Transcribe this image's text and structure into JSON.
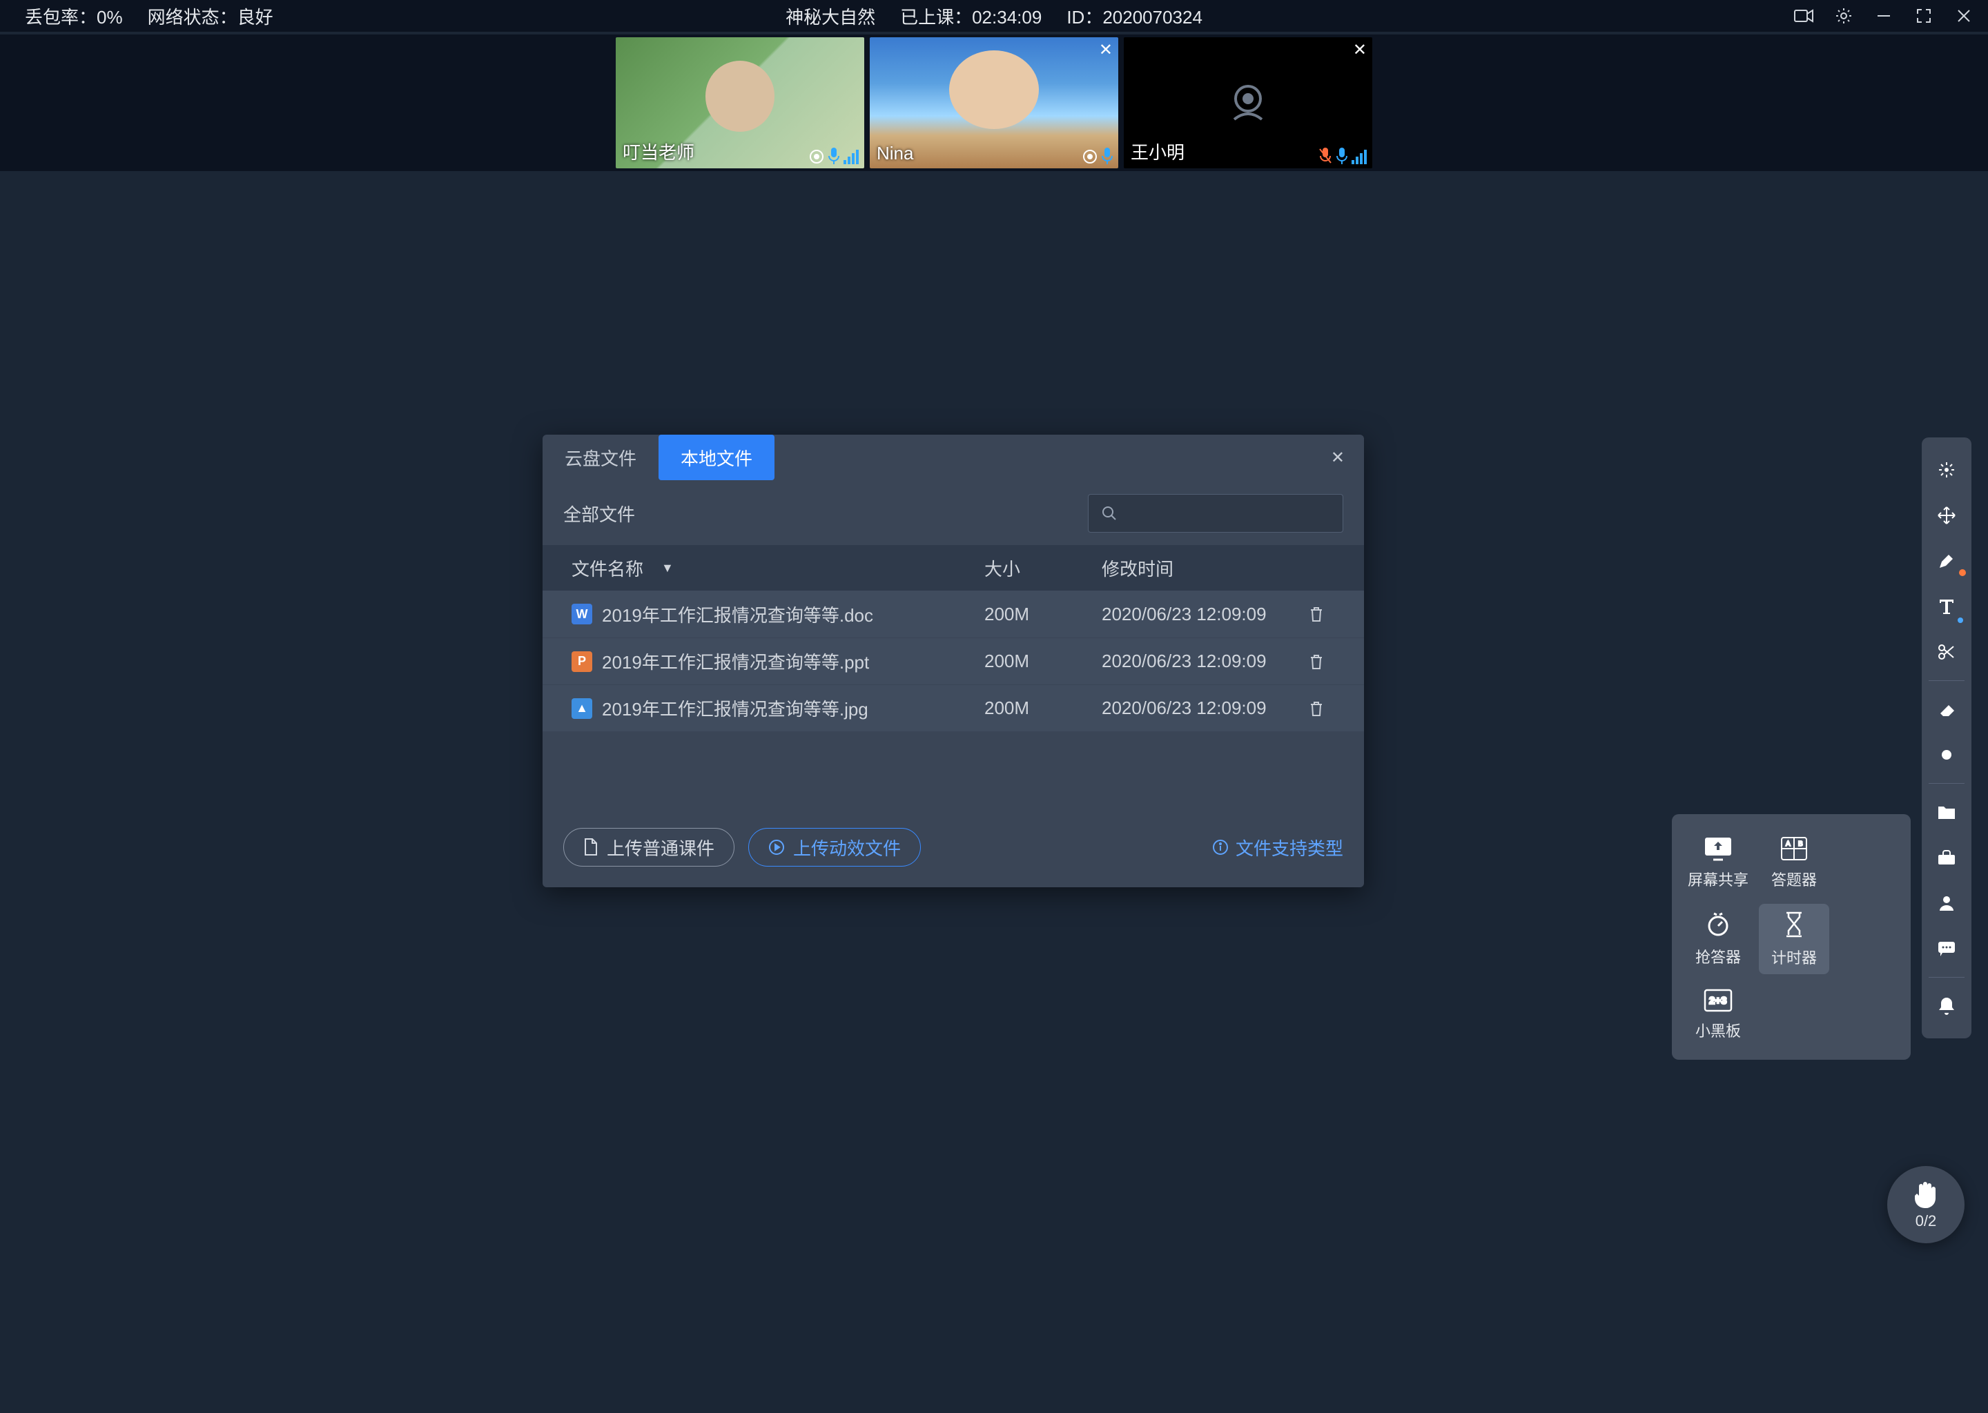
{
  "top": {
    "loss_label": "丢包率：",
    "loss_value": "0%",
    "net_label": "网络状态：",
    "net_value": "良好",
    "title": "神秘大自然",
    "elapsed_label": "已上课：",
    "elapsed_value": "02:34:09",
    "id_label": "ID：",
    "id_value": "2020070324"
  },
  "videos": [
    {
      "name": "叮当老师",
      "camera": true,
      "mic": "on",
      "closable": false
    },
    {
      "name": "Nina",
      "camera": true,
      "mic": "on",
      "closable": true
    },
    {
      "name": "王小明",
      "camera": false,
      "mic": "off",
      "closable": true
    }
  ],
  "dialog": {
    "tabs": {
      "cloud": "云盘文件",
      "local": "本地文件"
    },
    "all_files": "全部文件",
    "headers": {
      "name": "文件名称",
      "size": "大小",
      "time": "修改时间"
    },
    "rows": [
      {
        "icon": "W",
        "iconClass": "fi-doc",
        "name": "2019年工作汇报情况查询等等.doc",
        "size": "200M",
        "time": "2020/06/23 12:09:09"
      },
      {
        "icon": "P",
        "iconClass": "fi-ppt",
        "name": "2019年工作汇报情况查询等等.ppt",
        "size": "200M",
        "time": "2020/06/23 12:09:09"
      },
      {
        "icon": "▲",
        "iconClass": "fi-jpg",
        "name": "2019年工作汇报情况查询等等.jpg",
        "size": "200M",
        "time": "2020/06/23 12:09:09"
      }
    ],
    "btn_upload_normal": "上传普通课件",
    "btn_upload_anim": "上传动效文件",
    "support_link": "文件支持类型"
  },
  "popover": {
    "screen_share": "屏幕共享",
    "quiz": "答题器",
    "buzzer": "抢答器",
    "timer": "计时器",
    "blackboard": "小黑板"
  },
  "fab": {
    "count": "0/2"
  }
}
